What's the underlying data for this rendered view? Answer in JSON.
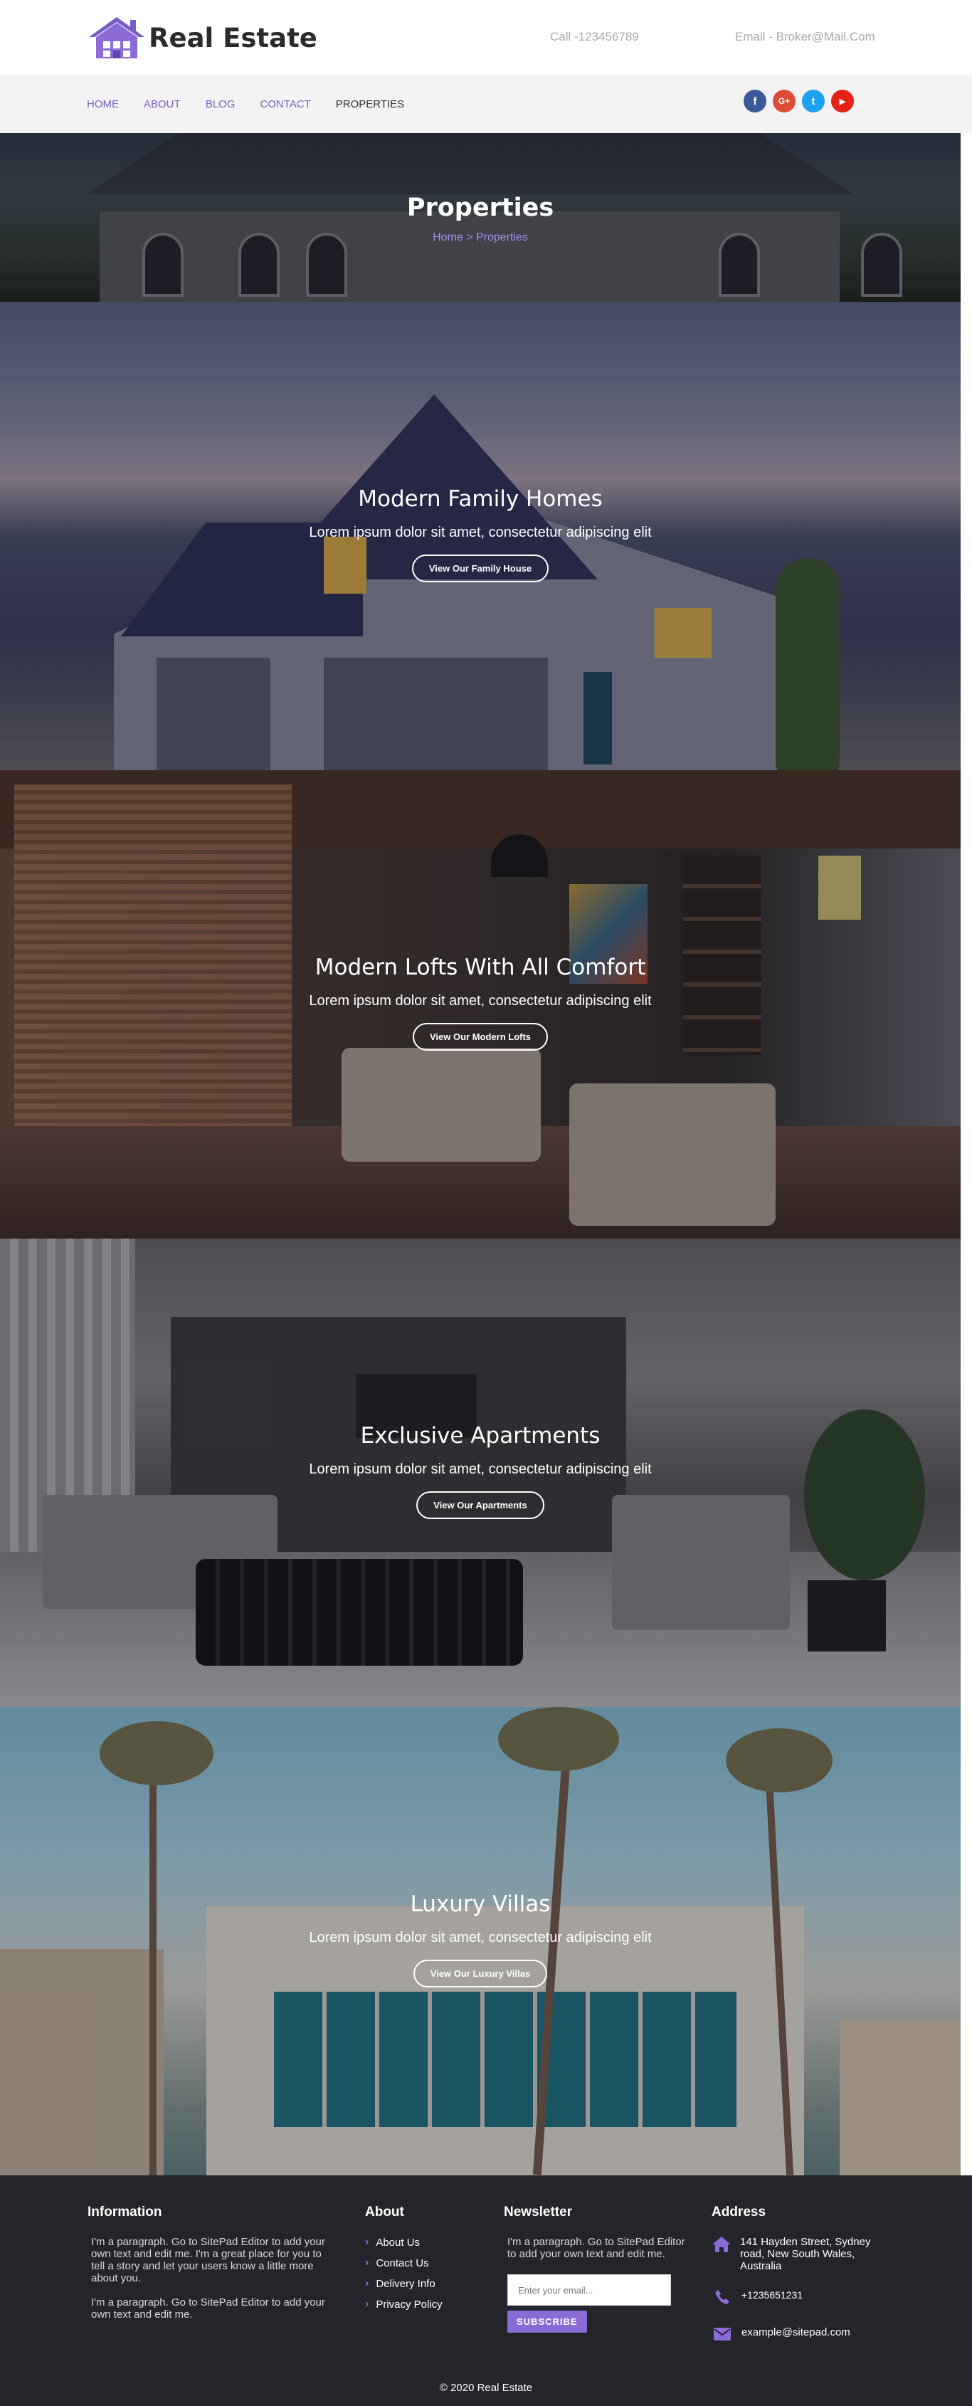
{
  "header": {
    "brand": "Real Estate",
    "call": "Call -123456789",
    "email": "Email - Broker@Mail.Com"
  },
  "nav": {
    "items": [
      "HOME",
      "ABOUT",
      "BLOG",
      "CONTACT",
      "PROPERTIES"
    ],
    "active": "PROPERTIES"
  },
  "socials": [
    {
      "name": "facebook",
      "glyph": "f",
      "color": "#3b5998"
    },
    {
      "name": "google-plus",
      "glyph": "G+",
      "color": "#dd4b39"
    },
    {
      "name": "twitter",
      "glyph": "t",
      "color": "#1da1f2"
    },
    {
      "name": "youtube",
      "glyph": "▶",
      "color": "#e62117"
    }
  ],
  "banner": {
    "title": "Properties",
    "breadcrumb_home": "Home",
    "breadcrumb_sep": " > ",
    "breadcrumb_current": "Properties"
  },
  "properties": [
    {
      "title": "Modern Family Homes",
      "desc": "Lorem ipsum dolor sit amet, consectetur adipiscing elit",
      "button": "View Our Family House"
    },
    {
      "title": "Modern Lofts With All Comfort",
      "desc": "Lorem ipsum dolor sit amet, consectetur adipiscing elit",
      "button": "View Our Modern Lofts"
    },
    {
      "title": "Exclusive Apartments",
      "desc": "Lorem ipsum dolor sit amet, consectetur adipiscing elit",
      "button": "View Our Apartments"
    },
    {
      "title": "Luxury Villas",
      "desc": "Lorem ipsum dolor sit amet, consectetur adipiscing elit",
      "button": "View Our Luxury Villas"
    }
  ],
  "footer": {
    "information": {
      "heading": "Information",
      "para1": "I'm a paragraph. Go to SitePad Editor to add your own text and edit me. I'm a great place for you to tell a story and let your users know a little more about you.",
      "para2": "I'm a paragraph. Go to SitePad Editor to add your own text and edit me."
    },
    "about": {
      "heading": "About",
      "links": [
        "About Us",
        "Contact Us",
        "Delivery Info",
        "Privacy Policy"
      ]
    },
    "newsletter": {
      "heading": "Newsletter",
      "para": "I'm a paragraph. Go to SitePad Editor to add your own text and edit me.",
      "placeholder": "Enter your email...",
      "button": "SUBSCRIBE"
    },
    "address": {
      "heading": "Address",
      "street": "141 Hayden Street, Sydney road, New South Wales, Australia",
      "phone": "+1235651231",
      "email": "example@sitepad.com"
    },
    "copyright": "© 2020 Real Estate"
  },
  "colors": {
    "accent": "#8b6cd6",
    "footer_bg": "#23252a",
    "nav_bg": "#f3f3f3"
  }
}
